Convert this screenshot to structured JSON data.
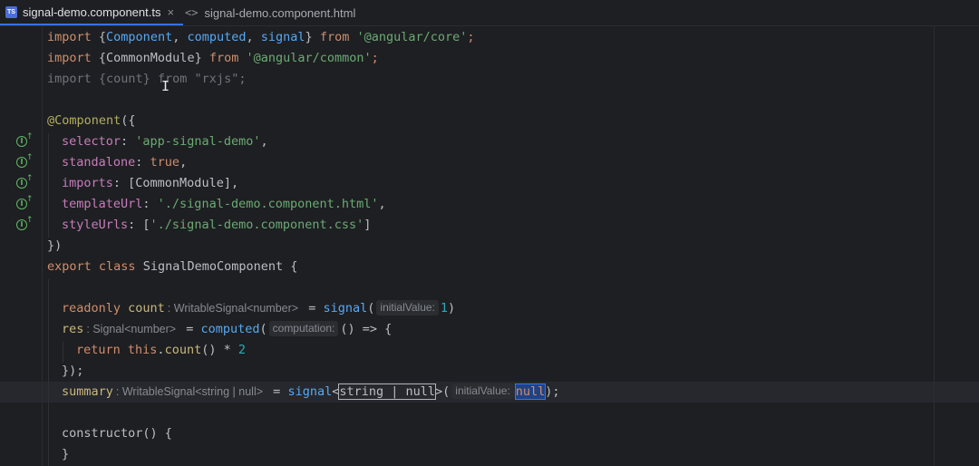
{
  "tabs": [
    {
      "label": "signal-demo.component.ts",
      "icon": "ts-file-icon",
      "badge": "TS",
      "active": true,
      "close_glyph": "×"
    },
    {
      "label": "signal-demo.component.html",
      "icon": "html-file-icon",
      "badge": "<>",
      "active": false
    }
  ],
  "code": {
    "l1": {
      "a": "import ",
      "b": "{",
      "c": "Component",
      "d": ", ",
      "e": "computed",
      "f": ", ",
      "g": "signal",
      "h": "} ",
      "i": "from ",
      "j": "'@angular/core'",
      "k": ";"
    },
    "l2": {
      "a": "import ",
      "b": "{CommonModule} ",
      "c": "from ",
      "d": "'@angular/common'",
      "e": ";"
    },
    "l3": {
      "a": "import {count} from \"rxjs\";"
    },
    "l5": {
      "a": "@Component",
      "b": "({"
    },
    "l6": {
      "a": "selector",
      "b": ": ",
      "c": "'app-signal-demo'",
      "d": ","
    },
    "l7": {
      "a": "standalone",
      "b": ": ",
      "c": "true",
      "d": ","
    },
    "l8": {
      "a": "imports",
      "b": ": [CommonModule],"
    },
    "l9": {
      "a": "templateUrl",
      "b": ": ",
      "c": "'./signal-demo.component.html'",
      "d": ","
    },
    "l10": {
      "a": "styleUrls",
      "b": ": [",
      "c": "'./signal-demo.component.css'",
      "d": "]"
    },
    "l11": {
      "a": "})"
    },
    "l12": {
      "a": "export ",
      "b": "class ",
      "c": "SignalDemoComponent ",
      "d": "{"
    },
    "l14": {
      "a": "readonly ",
      "b": "count",
      "hint": ": WritableSignal<number>",
      "c": " = ",
      "d": "signal",
      "e": "(",
      "hint2": "initialValue:",
      "f": "1",
      "g": ")"
    },
    "l15": {
      "a": "res",
      "hint": ": Signal<number>",
      "b": " = ",
      "c": "computed",
      "d": "(",
      "hint2": "computation:",
      "e": "() => {"
    },
    "l16": {
      "a": "return ",
      "b": "this",
      "c": ".",
      "d": "count",
      "e": "() * ",
      "f": "2"
    },
    "l17": {
      "a": "});"
    },
    "l18": {
      "a": "summary",
      "hint": ": WritableSignal<string | null>",
      "b": " = ",
      "c": "signal",
      "d": "<",
      "e": "string | null",
      "f": ">(",
      "hint2": "initialValue:",
      "g": "null",
      "h": ");"
    },
    "l20": {
      "a": "constructor",
      "b": "() {"
    },
    "l21": {
      "a": "}"
    }
  }
}
